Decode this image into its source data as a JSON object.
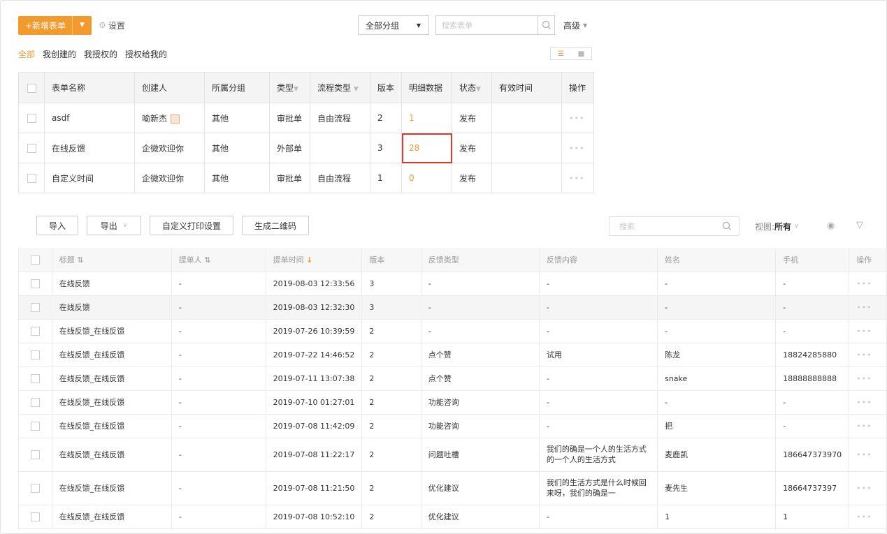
{
  "toolbar": {
    "new_form_label": "+新增表单",
    "settings_label": "设置",
    "group_select": "全部分组",
    "search_placeholder": "搜索表单",
    "advanced_label": "高级"
  },
  "filters": [
    "全部",
    "我创建的",
    "我授权的",
    "授权给我的"
  ],
  "forms_table": {
    "headers": [
      "表单名称",
      "创建人",
      "所属分组",
      "类型",
      "流程类型",
      "版本",
      "明细数据",
      "状态",
      "有效时间",
      "操作"
    ],
    "rows": [
      {
        "name": "asdf",
        "creator": "喻新杰",
        "group": "其他",
        "type": "审批单",
        "flow_type": "自由流程",
        "version": "2",
        "detail_count": "1",
        "status": "发布",
        "valid_time": ""
      },
      {
        "name": "在线反馈",
        "creator": "企微欢迎你",
        "group": "其他",
        "type": "外部单",
        "flow_type": "",
        "version": "3",
        "detail_count": "28",
        "status": "发布",
        "valid_time": ""
      },
      {
        "name": "自定义时间",
        "creator": "企微欢迎你",
        "group": "其他",
        "type": "审批单",
        "flow_type": "自由流程",
        "version": "1",
        "detail_count": "0",
        "status": "发布",
        "valid_time": ""
      }
    ]
  },
  "detail_toolbar": {
    "import_label": "导入",
    "export_label": "导出",
    "print_settings_label": "自定义打印设置",
    "qrcode_label": "生成二维码",
    "search_placeholder": "搜索",
    "view_label": "视图:",
    "view_value": "所有"
  },
  "detail_table": {
    "headers": [
      "标题",
      "提单人",
      "提单时间",
      "版本",
      "反馈类型",
      "反馈内容",
      "姓名",
      "手机",
      "操作"
    ],
    "rows": [
      {
        "title": "在线反馈",
        "submitter": "-",
        "time": "2019-08-03 12:33:56",
        "version": "3",
        "fb_type": "-",
        "fb_content": "-",
        "name": "-",
        "phone": "-"
      },
      {
        "title": "在线反馈",
        "submitter": "-",
        "time": "2019-08-03 12:32:30",
        "version": "3",
        "fb_type": "-",
        "fb_content": "-",
        "name": "-",
        "phone": "-"
      },
      {
        "title": "在线反馈_在线反馈",
        "submitter": "-",
        "time": "2019-07-26 10:39:59",
        "version": "2",
        "fb_type": "-",
        "fb_content": "-",
        "name": "-",
        "phone": "-"
      },
      {
        "title": "在线反馈_在线反馈",
        "submitter": "-",
        "time": "2019-07-22 14:46:52",
        "version": "2",
        "fb_type": "点个赞",
        "fb_content": "试用",
        "name": "陈龙",
        "phone": "18824285880"
      },
      {
        "title": "在线反馈_在线反馈",
        "submitter": "-",
        "time": "2019-07-11 13:07:38",
        "version": "2",
        "fb_type": "点个赞",
        "fb_content": "-",
        "name": "snake",
        "phone": "18888888888"
      },
      {
        "title": "在线反馈_在线反馈",
        "submitter": "-",
        "time": "2019-07-10 01:27:01",
        "version": "2",
        "fb_type": "功能咨询",
        "fb_content": "-",
        "name": "-",
        "phone": "-"
      },
      {
        "title": "在线反馈_在线反馈",
        "submitter": "-",
        "time": "2019-07-08 11:42:09",
        "version": "2",
        "fb_type": "功能咨询",
        "fb_content": "-",
        "name": "把",
        "phone": "-"
      },
      {
        "title": "在线反馈_在线反馈",
        "submitter": "-",
        "time": "2019-07-08 11:22:17",
        "version": "2",
        "fb_type": "问题吐槽",
        "fb_content": "我们的确是一个人的生活方式的一个人的生活方式",
        "name": "麦鹿凯",
        "phone": "186647373970"
      },
      {
        "title": "在线反馈_在线反馈",
        "submitter": "-",
        "time": "2019-07-08 11:21:50",
        "version": "2",
        "fb_type": "优化建议",
        "fb_content": "我们的生活方式是什么时候回来呀，我们的确是一",
        "name": "麦先生",
        "phone": "18664737397"
      },
      {
        "title": "在线反馈_在线反馈",
        "submitter": "-",
        "time": "2019-07-08 10:52:10",
        "version": "2",
        "fb_type": "优化建议",
        "fb_content": "-",
        "name": "1",
        "phone": "1"
      }
    ]
  },
  "colors": {
    "accent": "#f39a2c",
    "highlight_border": "#e0372b"
  }
}
